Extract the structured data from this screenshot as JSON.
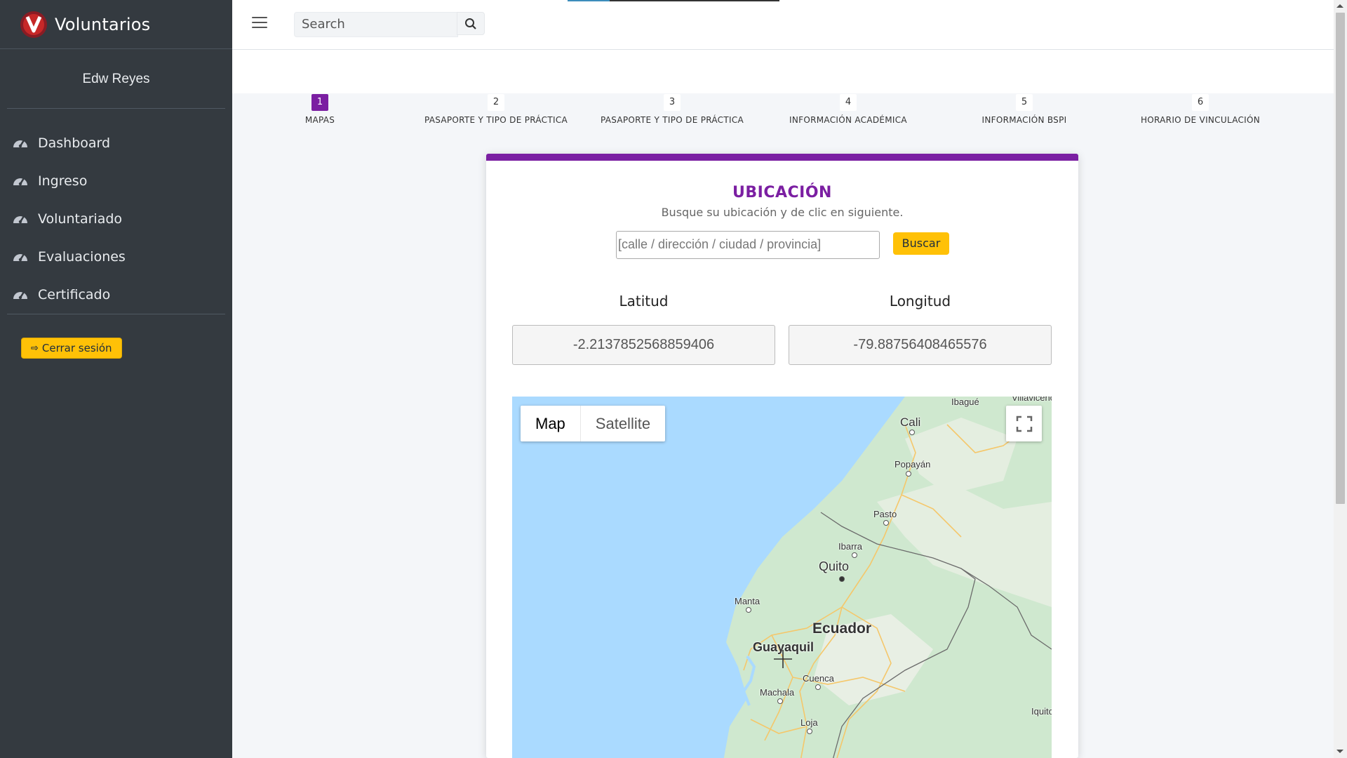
{
  "app": {
    "brand": "Voluntarios",
    "user": "Edw Reyes"
  },
  "sidebar": {
    "items": [
      {
        "label": "Dashboard",
        "icon": "tachometer-icon"
      },
      {
        "label": "Ingreso",
        "icon": "tachometer-icon"
      },
      {
        "label": "Voluntariado",
        "icon": "tachometer-icon"
      },
      {
        "label": "Evaluaciones",
        "icon": "tachometer-icon"
      },
      {
        "label": "Certificado",
        "icon": "tachometer-icon"
      }
    ],
    "logout_label": "Cerrar sesión"
  },
  "topbar": {
    "search_placeholder": "Search"
  },
  "steps": [
    {
      "num": "1",
      "label": "MAPAS",
      "active": true
    },
    {
      "num": "2",
      "label": "PASAPORTE Y TIPO DE PRÁCTICA",
      "active": false
    },
    {
      "num": "3",
      "label": "PASAPORTE Y TIPO DE PRÁCTICA",
      "active": false
    },
    {
      "num": "4",
      "label": "INFORMACIÓN ACADÉMICA",
      "active": false
    },
    {
      "num": "5",
      "label": "INFORMACIÓN BSPI",
      "active": false
    },
    {
      "num": "6",
      "label": "HORARIO DE VINCULACIÓN",
      "active": false
    }
  ],
  "form": {
    "title": "UBICACIÓN",
    "subtitle": "Busque su ubicación y de clic en siguiente.",
    "address_placeholder": "[calle / dirección / ciudad / provincia]",
    "search_button": "Buscar",
    "lat_label": "Latitud",
    "lng_label": "Longitud",
    "lat_value": "-2.2137852568859406",
    "lng_value": "-79.88756408465576"
  },
  "map": {
    "type_options": [
      "Map",
      "Satellite"
    ],
    "selected_type": "Map",
    "cities": [
      {
        "name": "Ibagué"
      },
      {
        "name": "Villavicencio"
      },
      {
        "name": "Cali"
      },
      {
        "name": "Popayán"
      },
      {
        "name": "Pasto"
      },
      {
        "name": "Ibarra"
      },
      {
        "name": "Quito"
      },
      {
        "name": "Manta"
      },
      {
        "name": "Ecuador"
      },
      {
        "name": "Guayaquil"
      },
      {
        "name": "Cuenca"
      },
      {
        "name": "Machala"
      },
      {
        "name": "Loja"
      },
      {
        "name": "Iquitos"
      }
    ],
    "colors": {
      "ocean": "#aadaff",
      "land": "#cfe8cf",
      "land_light": "#e8efe4",
      "roads": "#f5c76a",
      "borders": "#6b6b6b"
    }
  },
  "colors": {
    "accent": "#7b1fa2",
    "sidebar": "#343a40",
    "warning": "#ffc107"
  }
}
